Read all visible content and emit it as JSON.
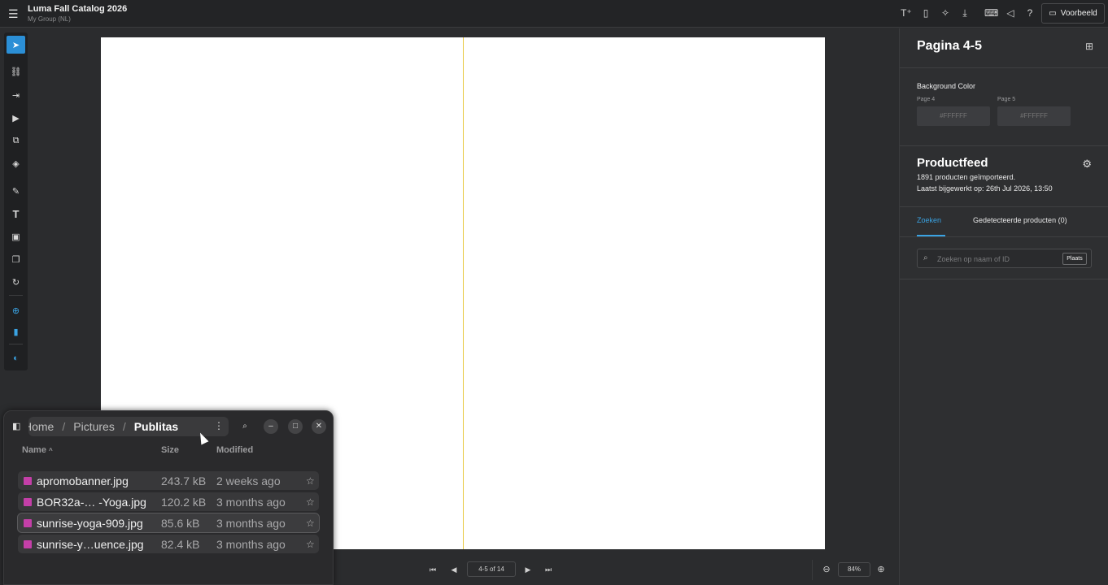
{
  "app": {
    "title": "Luma Fall Catalog 2026",
    "subtitle": "My Group (NL)"
  },
  "topbar": {
    "preview_label": "Voorbeeld"
  },
  "navigation": {
    "page_indicator": "4-5 of 14",
    "zoom": "84%"
  },
  "right_panel": {
    "title": "Pagina 4-5",
    "background": {
      "label": "Background Color",
      "page4_label": "Page 4",
      "page4_value": "#FFFFFF",
      "page5_label": "Page 5",
      "page5_value": "#FFFFFF"
    },
    "productfeed": {
      "title": "Productfeed",
      "imported": "1891 producten geïmporteerd.",
      "updated": "Laatst bijgewerkt op: 26th Jul 2026, 13:50"
    },
    "tabs": {
      "search": "Zoeken",
      "detected": "Gedetecteerde producten (0)"
    },
    "search": {
      "placeholder": "Zoeken op naam of ID",
      "place_button": "Plaats"
    }
  },
  "file_manager": {
    "breadcrumb": [
      "Home",
      "Pictures",
      "Publitas"
    ],
    "columns": {
      "name": "Name",
      "size": "Size",
      "modified": "Modified"
    },
    "files": [
      {
        "name": "apromobanner.jpg",
        "size": "243.7 kB",
        "modified": "2 weeks ago"
      },
      {
        "name": "BOR32a-… -Yoga.jpg",
        "size": "120.2 kB",
        "modified": "3 months ago"
      },
      {
        "name": "sunrise-yoga-909.jpg",
        "size": "85.6 kB",
        "modified": "3 months ago"
      },
      {
        "name": "sunrise-y…uence.jpg",
        "size": "82.4 kB",
        "modified": "3 months ago"
      }
    ]
  },
  "colors": {
    "accent": "#3aa3e3",
    "spine": "#e8c840",
    "file_icon": "#c43fa8"
  }
}
